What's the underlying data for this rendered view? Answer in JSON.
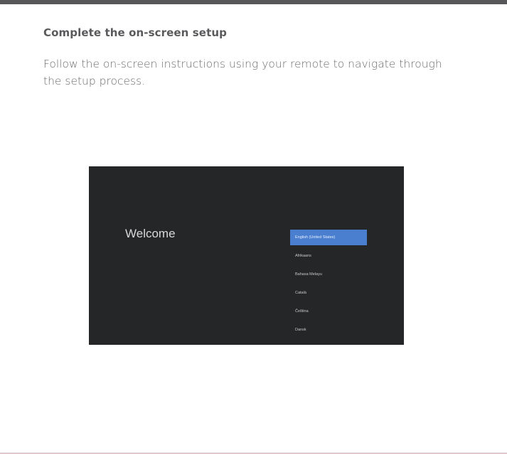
{
  "section": {
    "heading": "Complete the on-screen setup",
    "body": "Follow the on-screen instructions using your remote to navigate through the setup process."
  },
  "tv": {
    "welcome": "Welcome",
    "languages": [
      {
        "label": "English (United States)",
        "selected": true
      },
      {
        "label": "Afrikaans",
        "selected": false
      },
      {
        "label": "Bahasa Melayu",
        "selected": false
      },
      {
        "label": "Català",
        "selected": false
      },
      {
        "label": "Čeština",
        "selected": false
      },
      {
        "label": "Dansk",
        "selected": false
      }
    ],
    "background_color": "#252627",
    "highlight_color": "#4a7fd0"
  },
  "colors": {
    "top_bar": "#58585a",
    "heading": "#5a5a5c",
    "body": "#6d6d70"
  }
}
